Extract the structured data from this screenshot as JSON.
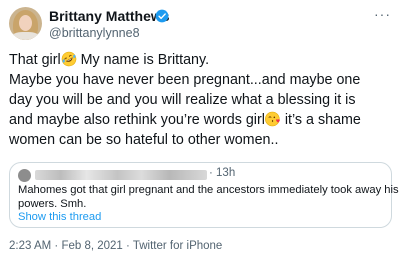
{
  "author": {
    "display_name": "Brittany Matthews",
    "handle": "@brittanylynne8",
    "verified": true,
    "avatar_icon": "profile-photo"
  },
  "tweet": {
    "lines": [
      {
        "before": "That girl",
        "emoji": "rolling-on-floor-laughing",
        "after": " My name is Brittany."
      },
      {
        "text": "Maybe you have never been pregnant...and maybe one"
      },
      {
        "text": "day you will be and you will realize what a blessing it is"
      },
      {
        "before": "and maybe also rethink you’re words girl",
        "emoji": "face-blowing-a-kiss",
        "after": " it’s a shame"
      },
      {
        "text": "women can be so hateful to other women.."
      }
    ]
  },
  "quoted_tweet": {
    "time": "· 13h",
    "lines": [
      "Mahomes got that girl pregnant and the ancestors immediately took away his",
      "powers.  Smh."
    ],
    "show_thread_label": "Show this thread"
  },
  "meta": {
    "time": "2:23 AM",
    "date": "Feb 8, 2021",
    "source": "Twitter for iPhone",
    "separator": " · "
  },
  "colors": {
    "verified_blue": "#1d9bf0",
    "link_blue": "#1d9bf0",
    "secondary_text": "#536471",
    "border": "#cfd9de"
  }
}
